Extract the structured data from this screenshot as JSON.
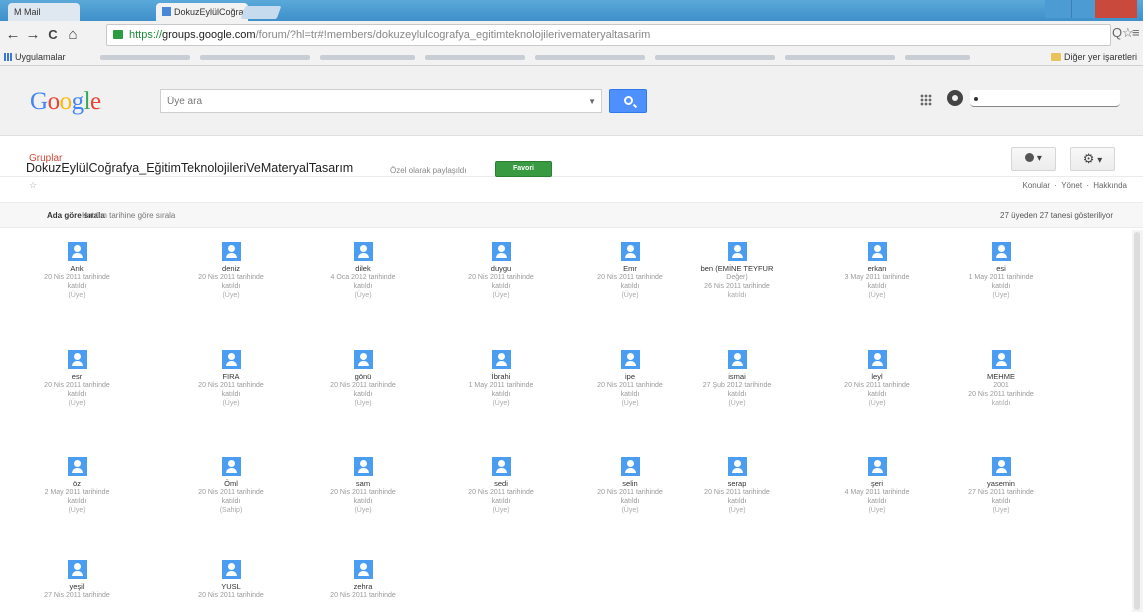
{
  "browser": {
    "tabs": [
      {
        "label": "M Mail"
      },
      {
        "label": "DokuzEylülCoğrafya_Eğit",
        "close": "×"
      }
    ],
    "nav": {
      "back": "←",
      "forward": "→",
      "reload": "C",
      "home": "⌂"
    },
    "url": {
      "scheme": "https://",
      "host": "groups.google.com",
      "path": "/forum/?hl=tr#!members/dokuzeylulcografya_egitimteknolojilerivemateryaltasarim"
    },
    "omni_icons": {
      "search": "Q",
      "star": "☆",
      "menu": "≡"
    },
    "bookmarks": {
      "apps_label": "Uygulamalar",
      "other_label": "Diğer yer işaretleri"
    }
  },
  "google": {
    "logo_letters": [
      {
        "ch": "G",
        "color": "#4285f4"
      },
      {
        "ch": "o",
        "color": "#ea4335"
      },
      {
        "ch": "o",
        "color": "#fbbc05"
      },
      {
        "ch": "g",
        "color": "#4285f4"
      },
      {
        "ch": "l",
        "color": "#34a853"
      },
      {
        "ch": "e",
        "color": "#ea4335"
      }
    ],
    "search_placeholder": "Üye ara"
  },
  "groups_bar": {
    "link": "Gruplar",
    "people_caret": "▾",
    "gear": "⚙",
    "gear_caret": "▾"
  },
  "group": {
    "title": "DokuzEylülCoğrafya_EğitimTeknolojileriVeMateryalTasarım",
    "share_text": "Özel olarak paylaşıldı",
    "favorite_button": "Favori",
    "star": "☆",
    "top_links": [
      "Konular",
      "Yönet",
      "Hakkında"
    ],
    "sort_by_name": "Ada göre sırala",
    "sort_by_date": "Katılım tarihine göre sırala",
    "member_count": "27 üyeden 27 tanesi gösteriliyor"
  },
  "members": [
    {
      "name": "Arık",
      "date": "20 Nis 2011 tarihinde",
      "joined": "katıldı",
      "role": "(Üye)"
    },
    {
      "name": "deniz",
      "date": "20 Nis 2011 tarihinde",
      "joined": "katıldı",
      "role": "(Üye)"
    },
    {
      "name": "dilek",
      "date": "4 Oca 2012 tarihinde",
      "joined": "katıldı",
      "role": "(Üye)"
    },
    {
      "name": "duygu",
      "date": "20 Nis 2011 tarihinde",
      "joined": "katıldı",
      "role": "(Üye)"
    },
    {
      "name": "Emr",
      "date": "20 Nis 2011 tarihinde",
      "joined": "katıldı",
      "role": "(Üye)"
    },
    {
      "name": "ben (EMİNE TEYFUR",
      "date": "Değer)",
      "joined": "26 Nis 2011 tarihinde",
      "role": "katıldı"
    },
    {
      "name": "erkan",
      "date": "3 May 2011 tarihinde",
      "joined": "katıldı",
      "role": "(Üye)"
    },
    {
      "name": "esi",
      "date": "1 May 2011 tarihinde",
      "joined": "katıldı",
      "role": "(Üye)"
    },
    {
      "name": "esr",
      "date": "20 Nis 2011 tarihinde",
      "joined": "katıldı",
      "role": "(Üye)"
    },
    {
      "name": "FIRA",
      "date": "20 Nis 2011 tarihinde",
      "joined": "katıldı",
      "role": "(Üye)"
    },
    {
      "name": "gönü",
      "date": "20 Nis 2011 tarihinde",
      "joined": "katıldı",
      "role": "(Üye)"
    },
    {
      "name": "İbrahi",
      "date": "1 May 2011 tarihinde",
      "joined": "katıldı",
      "role": "(Üye)"
    },
    {
      "name": "ipe",
      "date": "20 Nis 2011 tarihinde",
      "joined": "katıldı",
      "role": "(Üye)"
    },
    {
      "name": "ismai",
      "date": "27 Şub 2012 tarihinde",
      "joined": "katıldı",
      "role": "(Üye)"
    },
    {
      "name": "leyl",
      "date": "20 Nis 2011 tarihinde",
      "joined": "katıldı",
      "role": "(Üye)"
    },
    {
      "name": "MEHME",
      "date": "2001",
      "joined": "20 Nis 2011 tarihinde",
      "role": "katıldı"
    },
    {
      "name": "öz",
      "date": "2 May 2011 tarihinde",
      "joined": "katıldı",
      "role": "(Üye)"
    },
    {
      "name": "Öml",
      "date": "20 Nis 2011 tarihinde",
      "joined": "katıldı",
      "role": "(Sahip)"
    },
    {
      "name": "sam",
      "date": "20 Nis 2011 tarihinde",
      "joined": "katıldı",
      "role": "(Üye)"
    },
    {
      "name": "sedi",
      "date": "20 Nis 2011 tarihinde",
      "joined": "katıldı",
      "role": "(Üye)"
    },
    {
      "name": "selin",
      "date": "20 Nis 2011 tarihinde",
      "joined": "katıldı",
      "role": "(Üye)"
    },
    {
      "name": "serap",
      "date": "20 Nis 2011 tarihinde",
      "joined": "katıldı",
      "role": "(Üye)"
    },
    {
      "name": "şeri",
      "date": "4 May 2011 tarihinde",
      "joined": "katıldı",
      "role": "(Üye)"
    },
    {
      "name": "yasemin",
      "date": "27 Nis 2011 tarihinde",
      "joined": "katıldı",
      "role": "(Üye)"
    },
    {
      "name": "yeşil",
      "date": "27 Nis 2011 tarihinde",
      "joined": "",
      "role": ""
    },
    {
      "name": "YUSL",
      "date": "20 Nis 2011 tarihinde",
      "joined": "",
      "role": ""
    },
    {
      "name": "zehra",
      "date": "20 Nis 2011 tarihinde",
      "joined": "",
      "role": ""
    }
  ]
}
